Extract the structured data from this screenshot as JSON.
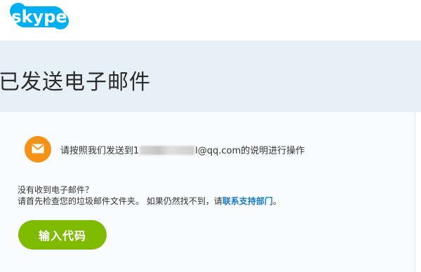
{
  "header": {
    "logo_text": "skype"
  },
  "page_title": "已发送电子邮件",
  "notice": {
    "icon": "envelope-icon",
    "text_before": "请按照我们发送到1",
    "text_after": "l@qq.com的说明进行操作"
  },
  "help": {
    "heading": "没有收到电子邮件？",
    "text": "请首先检查您的垃圾邮件文件夹。 如果仍然找不到，请",
    "link_label": "联系支持部门",
    "text_end": "。"
  },
  "actions": {
    "enter_code_label": "输入代码"
  },
  "colors": {
    "brand": "#00aff0",
    "accent_orange": "#f29318",
    "button_green": "#7fb900",
    "link_blue": "#1a7cc4"
  }
}
